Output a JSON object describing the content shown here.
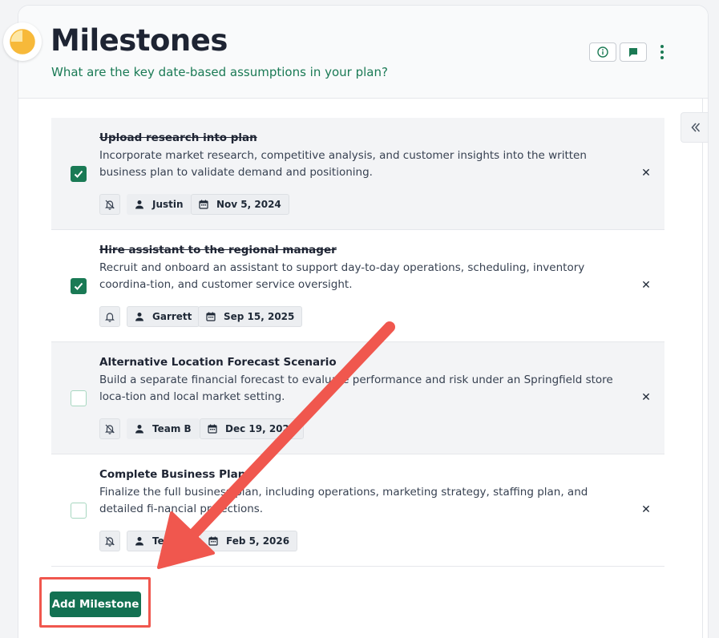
{
  "header": {
    "title": "Milestones",
    "subtitle": "What are the key date-based assumptions in your plan?"
  },
  "milestones": [
    {
      "title": "Upload research into plan",
      "description": "Incorporate market research, competitive analysis, and customer insights into the written business plan to validate demand and positioning.",
      "completed": true,
      "reminder_icon": "bell-off-icon",
      "assignee": "Justin",
      "date": "Nov 5, 2024"
    },
    {
      "title": "Hire assistant to the regional manager",
      "description": "Recruit and onboard an assistant to support day-to-day operations, scheduling, inventory coordina-tion, and customer service oversight.",
      "completed": true,
      "reminder_icon": "bell-icon",
      "assignee": "Garrett",
      "date": "Sep 15, 2025"
    },
    {
      "title": "Alternative Location Forecast Scenario",
      "description": "Build a separate financial forecast to evaluate performance and risk under an Springfield store loca-tion and local market setting.",
      "completed": false,
      "reminder_icon": "bell-off-icon",
      "assignee": "Team B",
      "date": "Dec 19, 2025"
    },
    {
      "title": "Complete Business Plan",
      "description": "Finalize the full business plan, including operations, marketing strategy, staffing plan, and detailed fi-nancial projections.",
      "completed": false,
      "reminder_icon": "bell-off-icon",
      "assignee": "Team",
      "date": "Feb 5, 2026"
    }
  ],
  "actions": {
    "add_milestone": "Add Milestone"
  },
  "colors": {
    "brand_green": "#137152",
    "subtitle_green": "#1a7a55",
    "annotation_red": "#f0574e"
  }
}
